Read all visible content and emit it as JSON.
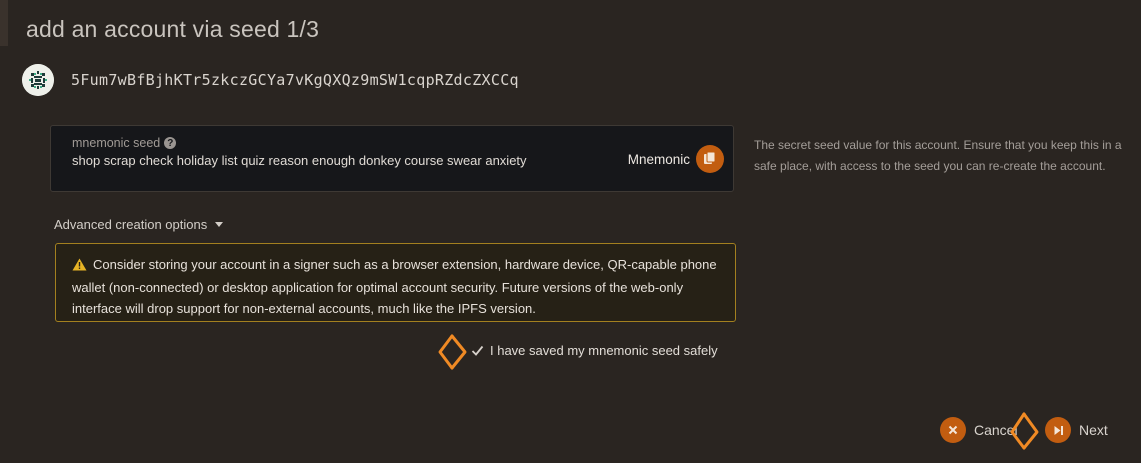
{
  "modal": {
    "title": "add an account via seed 1/3"
  },
  "account": {
    "address": "5Fum7wBfBjhKTr5zkczGCYa7vKgQXQz9mSW1cqpRZdcZXCCq",
    "avatar_icon": "identicon-icon"
  },
  "seed": {
    "label": "mnemonic seed",
    "value": "shop scrap check holiday list quiz reason enough donkey course swear anxiety",
    "type_label": "Mnemonic",
    "help_text": "The secret seed value for this account. Ensure that you keep this in a safe place, with access to the seed you can re-create the account."
  },
  "advanced": {
    "label": "Advanced creation options"
  },
  "warning": {
    "text": "Consider storing your account in a signer such as a browser extension, hardware device, QR-capable phone wallet (non-connected) or desktop application for optimal account security. Future versions of the web-only interface will drop support for non-external accounts, much like the IPFS version."
  },
  "confirm": {
    "label": "I have saved my mnemonic seed safely",
    "checked": true
  },
  "actions": {
    "cancel_label": "Cancel",
    "next_label": "Next"
  },
  "colors": {
    "background": "#2a2521",
    "accent": "#c25d10",
    "warning_border": "#a3801f",
    "cursor": "#f08a24"
  }
}
